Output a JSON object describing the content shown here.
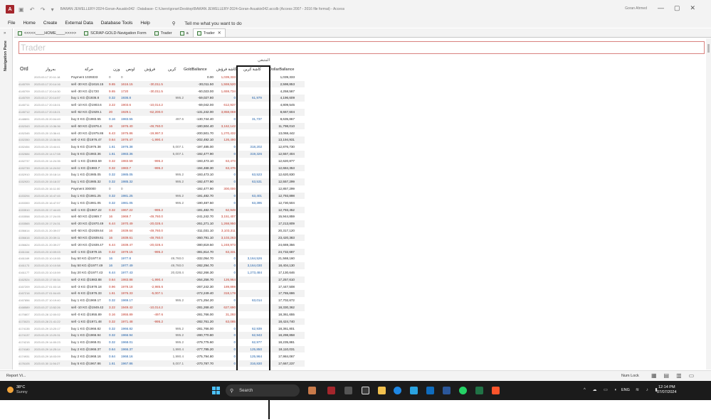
{
  "titlebar": {
    "app_icon": "A",
    "title": "BAWAN JEWELLERY-2024-Goran-Asuakix042 : Database- C:\\Users\\goran\\Desktop\\BAWAN JEWELLERY-2024-Goran-Asuakix042.accdb (Access 2007 - 2016 file format) - Access",
    "user": "Goran Ahmed"
  },
  "menu": {
    "file": "File",
    "home": "Home",
    "create": "Create",
    "external_data": "External Data",
    "database_tools": "Database Tools",
    "help": "Help",
    "tell_me": "Tell me what you want to do"
  },
  "nav_pane": {
    "label": "Navigation Pane"
  },
  "tabs": [
    {
      "label": "<<<<<____HOME____>>>>>"
    },
    {
      "label": "SCRAP-GOLD-Navigation Form"
    },
    {
      "label": "Trader"
    },
    {
      "label": "a"
    },
    {
      "label": "Trader"
    }
  ],
  "form": {
    "title": "Trader",
    "group_header": "المتبقي",
    "columns": {
      "ord": "Ord",
      "date": "بەروار",
      "op": "حركة",
      "weight": "وزن",
      "ounce": "اونص",
      "diff": "فرۆش",
      "buy": "كرين",
      "gold_balance": "GoldBallance",
      "sell_cash": "كاشة فرۆش",
      "buy_cash": "كاشة كرين",
      "dollar_balance": "DollarBallance"
    }
  },
  "rows": [
    {
      "id": "",
      "dt": "2023.03.17 20:11:18",
      "op": "Payment 1039333",
      "wt": "0",
      "ou": "0",
      "fr": "",
      "cr": "",
      "gb": "0.00",
      "kf": "1,039,333",
      "kk": "",
      "db": "1,039,333",
      "hl": ""
    },
    {
      "id": "4145709",
      "dt": "2023.03.17 20:14:16",
      "op": "sell -30 KG @1616.15",
      "wt": "9.65",
      "ou": "1616.15",
      "fr": "-30,011.5",
      "cr": "",
      "gb": "-30,011.50",
      "kf": "1,559,520",
      "kk": "",
      "db": "2,598,853",
      "hl": "r"
    },
    {
      "id": "4145709",
      "dt": "2023.03.17 20:14:30",
      "op": "sell -30 KG @1720",
      "wt": "9.65",
      "ou": "1720",
      "fr": "-30,011.5",
      "cr": "",
      "gb": "-60,023.00",
      "kf": "1,659,734",
      "kk": "",
      "db": "4,258,587",
      "hl": "r"
    },
    {
      "id": "4145709",
      "dt": "2023.03.17 20:14:57",
      "op": "buy 1 KG @1936.8",
      "wt": "0.32",
      "ou": "1936.8",
      "fr": "",
      "cr": "995.2",
      "gb": "-59,027.80",
      "kf": "0",
      "kk": "61,979",
      "db": "4,196,609",
      "hl": "b"
    },
    {
      "id": "4145711",
      "dt": "2023.03.17 20:15:01",
      "op": "sell -10 KG @1903.6",
      "wt": "3.22",
      "ou": "1903.6",
      "fr": "-10,014.2",
      "cr": "",
      "gb": "-69,042.00",
      "kf": "612,937",
      "kk": "",
      "db": "4,809,545",
      "hl": "r"
    },
    {
      "id": "4145712",
      "dt": "2023.03.17 20:15:21",
      "op": "sell -62 KG @1929.1",
      "wt": "20",
      "ou": "1929.1",
      "fr": "-62,200.0",
      "cr": "",
      "gb": "-131,242.00",
      "kf": "3,858,059",
      "kk": "",
      "db": "8,667,604",
      "hl": "r"
    },
    {
      "id": "4148691",
      "dt": "2023.03.20 20:04:49",
      "op": "buy 0 KG @1983.55",
      "wt": "0.16",
      "ou": "1983.55",
      "fr": "",
      "cr": "497.6",
      "gb": "-130,744.40",
      "kf": "0",
      "kk": "31,737",
      "db": "8,635,867",
      "hl": "b"
    },
    {
      "id": "4152343",
      "dt": "2023.03.20 13:36:36",
      "op": "sell -50 KG @1976.4",
      "wt": "16",
      "ou": "1976.40",
      "fr": "-49,760.0",
      "cr": "",
      "gb": "-180,504.40",
      "kf": "3,162,142",
      "kk": "",
      "db": "11,798,010",
      "hl": "r"
    },
    {
      "id": "4152345",
      "dt": "2023.03.20 13:36:41",
      "op": "sell -20 KG @1975.86",
      "wt": "6.43",
      "ou": "1975.86",
      "fr": "-19,997.3",
      "cr": "",
      "gb": "-200,501.70",
      "kf": "1,270,432",
      "kk": "",
      "db": "13,068,442",
      "hl": "r"
    },
    {
      "id": "4152350",
      "dt": "2023.03.20 13:36:56",
      "op": "sell -2 KG @1976.47",
      "wt": "0.64",
      "ou": "1976.47",
      "fr": "-1,990.4",
      "cr": "",
      "gb": "-202,492.10",
      "kf": "126,490",
      "kk": "",
      "db": "13,194,931",
      "hl": "r"
    },
    {
      "id": "4152454",
      "dt": "2023.03.20 13:44:41",
      "op": "buy 5 KG @1976.38",
      "wt": "1.61",
      "ou": "1976.38",
      "fr": "",
      "cr": "5,007.1",
      "gb": "-197,485.00",
      "kf": "0",
      "kk": "318,202",
      "db": "12,876,730",
      "hl": "b"
    },
    {
      "id": "4152684",
      "dt": "2023.03.20 14:17:08",
      "op": "buy 5 KG @1983.36",
      "wt": "1.61",
      "ou": "1983.36",
      "fr": "",
      "cr": "5,007.1",
      "gb": "-192,477.90",
      "kf": "0",
      "kk": "319,326",
      "db": "12,557,404",
      "hl": "b"
    },
    {
      "id": "4152737",
      "dt": "2023.03.20 14:24:35",
      "op": "sell -1 KG @1983.59",
      "wt": "0.32",
      "ou": "1983.59",
      "fr": "-995.2",
      "cr": "",
      "gb": "-193,473.10",
      "kf": "63,473",
      "kk": "",
      "db": "12,620,877",
      "hl": "r"
    },
    {
      "id": "4152739",
      "dt": "2023.03.20 14:24:52",
      "op": "sell -1 KG @1983.7",
      "wt": "0.32",
      "ou": "1983.7",
      "fr": "-995.2",
      "cr": "",
      "gb": "-194,468.30",
      "kf": "63,476",
      "kk": "",
      "db": "12,684,353",
      "hl": "r"
    },
    {
      "id": "4152910",
      "dt": "2023.03.20 15:18:14",
      "op": "buy 1 KG @1985.05",
      "wt": "0.32",
      "ou": "1985.05",
      "fr": "",
      "cr": "995.2",
      "gb": "-193,473.10",
      "kf": "0",
      "kk": "63,523",
      "db": "12,620,830",
      "hl": "b"
    },
    {
      "id": "4152920",
      "dt": "2023.03.20 15:18:37",
      "op": "buy 1 KG @1985.32",
      "wt": "0.32",
      "ou": "1985.32",
      "fr": "",
      "cr": "995.2",
      "gb": "-192,477.90",
      "kf": "0",
      "kk": "63,531",
      "db": "12,557,299",
      "hl": "b"
    },
    {
      "id": "",
      "dt": "2023.03.20 16:11:00",
      "op": "Payment 300000",
      "wt": "0",
      "ou": "0",
      "fr": "",
      "cr": "",
      "gb": "-192,477.90",
      "kf": "300,000",
      "kk": "",
      "db": "12,857,299",
      "hl": ""
    },
    {
      "id": "4153294",
      "dt": "2023.03.20 16:47:45",
      "op": "buy 1 KG @1981.25",
      "wt": "0.32",
      "ou": "1981.25",
      "fr": "",
      "cr": "995.2",
      "gb": "-191,482.70",
      "kf": "0",
      "kk": "63,401",
      "db": "12,793,898",
      "hl": "b"
    },
    {
      "id": "4153300",
      "dt": "2023.03.20 16:47:57",
      "op": "buy 1 KG @1981.05",
      "wt": "0.32",
      "ou": "1981.05",
      "fr": "",
      "cr": "995.2",
      "gb": "-190,487.50",
      "kf": "0",
      "kk": "63,395",
      "db": "12,730,504",
      "hl": "b"
    },
    {
      "id": "4153510",
      "dt": "2023.03.20 17:44:45",
      "op": "sell -1 KG @1967.22",
      "wt": "0.32",
      "ou": "1967.22",
      "fr": "-995.2",
      "cr": "",
      "gb": "-191,482.70",
      "kf": "62,949",
      "kk": "",
      "db": "12,793,452",
      "hl": "r"
    },
    {
      "id": "4153558",
      "dt": "2023.03.20 17:24:05",
      "op": "sell -50 KG @1969.7",
      "wt": "16",
      "ou": "1969.7",
      "fr": "-49,760.0",
      "cr": "",
      "gb": "-241,242.70",
      "kf": "3,151,407",
      "kk": "",
      "db": "15,944,859",
      "hl": "r"
    },
    {
      "id": "4153565",
      "dt": "2023.03.20 17:24:31",
      "op": "sell -20 KG @1970.49",
      "wt": "6.44",
      "ou": "1970.49",
      "fr": "-20,028.4",
      "cr": "",
      "gb": "-261,271.10",
      "kf": "1,268,950",
      "kk": "",
      "db": "17,213,809",
      "hl": "r"
    },
    {
      "id": "4156614",
      "dt": "2023.03.21 20:39:07",
      "op": "sell -50 KG @1939.64",
      "wt": "16",
      "ou": "1939.64",
      "fr": "-49,760.0",
      "cr": "",
      "gb": "-311,031.10",
      "kf": "3,103,311",
      "kk": "",
      "db": "20,317,120",
      "hl": "r"
    },
    {
      "id": "4156616",
      "dt": "2023.03.21 20:39:11",
      "op": "sell -50 KG @1939.61",
      "wt": "16",
      "ou": "1939.61",
      "fr": "-49,760.0",
      "cr": "",
      "gb": "-360,791.10",
      "kf": "3,103,263",
      "kk": "",
      "db": "23,420,383",
      "hl": "r"
    },
    {
      "id": "4156624",
      "dt": "2023.03.21 20:39:27",
      "op": "sell -20 KG @1939.47",
      "wt": "6.44",
      "ou": "1939.47",
      "fr": "-20,028.4",
      "cr": "",
      "gb": "-380,819.50",
      "kf": "1,248,973",
      "kk": "",
      "db": "24,669,356",
      "hl": "r"
    },
    {
      "id": "4161164",
      "dt": "2023.03.23 10:09:03",
      "op": "sell -1 KG @1979.15",
      "wt": "0.32",
      "ou": "1979.15",
      "fr": "-995.2",
      "cr": "",
      "gb": "-381,814.70",
      "kf": "63,331",
      "kk": "",
      "db": "24,732,687",
      "hl": "r"
    },
    {
      "id": "4161169",
      "dt": "2023.03.23 10:10:55",
      "op": "buy 50 KG @1977.8",
      "wt": "16",
      "ou": "1977.8",
      "fr": "",
      "cr": "49,760.0",
      "gb": "-332,054.70",
      "kf": "0",
      "kk": "3,164,526",
      "db": "21,568,160",
      "hl": "b"
    },
    {
      "id": "4161173",
      "dt": "2023.03.23 10:10:58",
      "op": "buy 50 KG @1977.49",
      "wt": "16",
      "ou": "1977.49",
      "fr": "",
      "cr": "49,760.0",
      "gb": "-282,294.70",
      "kf": "0",
      "kk": "3,164,030",
      "db": "18,404,130",
      "hl": "b"
    },
    {
      "id": "4161177",
      "dt": "2023.03.23 10:10:59",
      "op": "buy 20 KG @1977.43",
      "wt": "6.44",
      "ou": "1977.43",
      "fr": "",
      "cr": "20,028.4",
      "gb": "-262,266.30",
      "kf": "0",
      "kk": "1,273,484",
      "db": "17,130,646",
      "hl": "b"
    },
    {
      "id": "4162524",
      "dt": "2023.03.23 17:00:34",
      "op": "sell -2 KG @1983.88",
      "wt": "0.64",
      "ou": "1983.88",
      "fr": "-1,990.4",
      "cr": "",
      "gb": "-264,256.70",
      "kf": "126,964",
      "kk": "",
      "db": "17,257,610",
      "hl": "r"
    },
    {
      "id": "4167209",
      "dt": "2023.03.27 01:03:18",
      "op": "sell -3 KG @1978.18",
      "wt": "0.96",
      "ou": "1978.18",
      "fr": "-2,985.6",
      "cr": "",
      "gb": "-267,242.30",
      "kf": "189,898",
      "kk": "",
      "db": "17,447,508",
      "hl": "r"
    },
    {
      "id": "4167216",
      "dt": "2023.03.27 01:04:45",
      "op": "sell -5 KG @1976.33",
      "wt": "1.61",
      "ou": "1976.33",
      "fr": "-5,007.1",
      "cr": "",
      "gb": "-272,249.40",
      "kf": "318,178",
      "kk": "",
      "db": "17,765,686",
      "hl": "r"
    },
    {
      "id": "4167856",
      "dt": "2023.03.27 10:19:40",
      "op": "buy 1 KG @1969.17",
      "wt": "0.32",
      "ou": "1969.17",
      "fr": "",
      "cr": "995.2",
      "gb": "-271,254.20",
      "kf": "0",
      "kk": "63,014",
      "db": "17,702,672",
      "hl": "b"
    },
    {
      "id": "4168589",
      "dt": "2023.03.27 13:52:26",
      "op": "sell -10 KG @1949.42",
      "wt": "3.22",
      "ou": "1949.42",
      "fr": "-10,014.2",
      "cr": "",
      "gb": "-281,268.40",
      "kf": "627,690",
      "kk": "",
      "db": "18,330,362",
      "hl": "r"
    },
    {
      "id": "4170807",
      "dt": "2023.03.28 12:00:02",
      "op": "sell -0 KG @1955.89",
      "wt": "0.16",
      "ou": "1955.89",
      "fr": "-497.6",
      "cr": "",
      "gb": "-281,766.00",
      "kf": "31,293",
      "kk": "",
      "db": "18,361,655",
      "hl": "r"
    },
    {
      "id": "4173023",
      "dt": "2023.03.28 21:41:22",
      "op": "sell -1 KG @1971.48",
      "wt": "0.32",
      "ou": "1971.48",
      "fr": "-995.2",
      "cr": "",
      "gb": "-282,761.20",
      "kf": "63,085",
      "kk": "",
      "db": "18,424,740",
      "hl": "r"
    },
    {
      "id": "4174135",
      "dt": "2023.03.29 13:20:17",
      "op": "buy 1 KG @1966.82",
      "wt": "0.32",
      "ou": "1966.82",
      "fr": "",
      "cr": "995.2",
      "gb": "-281,766.00",
      "kf": "0",
      "kk": "62,939",
      "db": "18,361,801",
      "hl": "b"
    },
    {
      "id": "4174137",
      "dt": "2023.03.29 13:20:31",
      "op": "buy 1 KG @1966.94",
      "wt": "0.32",
      "ou": "1966.94",
      "fr": "",
      "cr": "995.2",
      "gb": "-280,770.80",
      "kf": "0",
      "kk": "62,943",
      "db": "18,298,858",
      "hl": "b"
    },
    {
      "id": "4174215",
      "dt": "2023.03.29 14:00:23",
      "op": "buy 1 KG @1968.01",
      "wt": "0.32",
      "ou": "1968.01",
      "fr": "",
      "cr": "995.2",
      "gb": "-279,775.60",
      "kf": "0",
      "kk": "62,977",
      "db": "18,235,881",
      "hl": "b"
    },
    {
      "id": "4174180",
      "dt": "2023.03.29 14:25:14",
      "op": "buy 2 KG @1966.37",
      "wt": "0.64",
      "ou": "1966.37",
      "fr": "",
      "cr": "1,990.4",
      "gb": "-277,785.20",
      "kf": "0",
      "kk": "125,850",
      "db": "18,110,031",
      "hl": "b"
    },
    {
      "id": "4174931",
      "dt": "2023.03.29 18:03:09",
      "op": "buy 2 KG @1968.16",
      "wt": "0.64",
      "ou": "1968.16",
      "fr": "",
      "cr": "1,990.4",
      "gb": "-275,794.80",
      "kf": "0",
      "kk": "125,964",
      "db": "17,984,067",
      "hl": "b"
    },
    {
      "id": "4176105",
      "dt": "2023.03.30 11:56:27",
      "op": "buy 5 KG @1967.86",
      "wt": "1.61",
      "ou": "1967.86",
      "fr": "",
      "cr": "5,007.1",
      "gb": "-270,787.70",
      "kf": "0",
      "kk": "316,830",
      "db": "17,667,237",
      "hl": "b"
    }
  ],
  "status": {
    "left": "Report Vi...",
    "num_lock": "Num Lock"
  },
  "taskbar": {
    "temperature": "38°C",
    "weather": "Sunny",
    "search": "Search",
    "language": "ENG",
    "time": "12:14 PM",
    "date": "07/07/2024"
  },
  "colors": {
    "sell": "#c0392b",
    "buy": "#1f5fa8",
    "title_border": "#d9827f",
    "access_brand": "#a4262c"
  }
}
